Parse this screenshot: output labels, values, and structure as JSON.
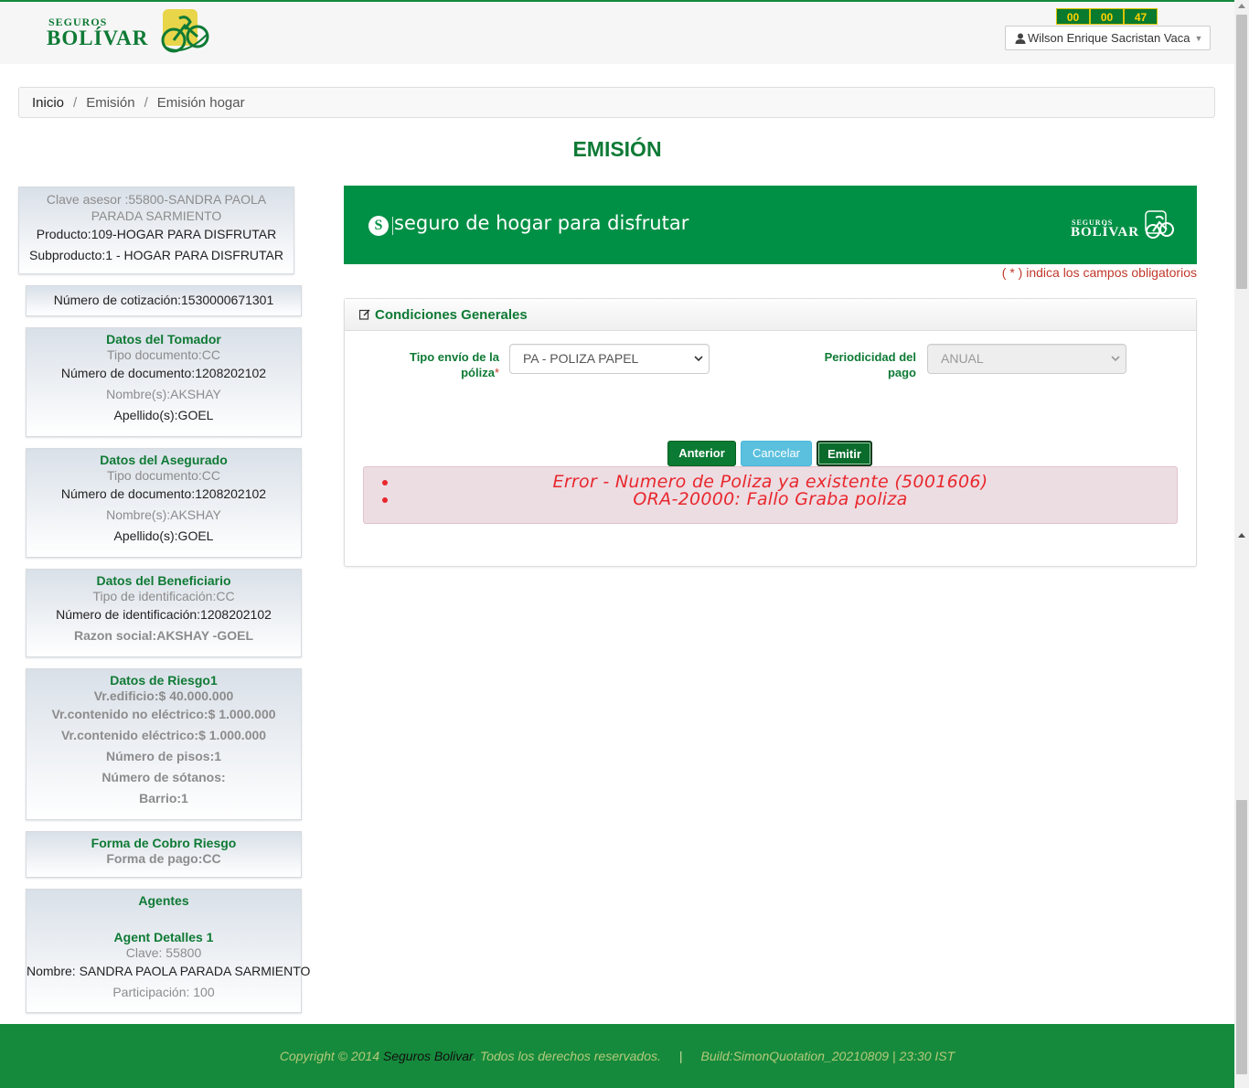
{
  "header": {
    "brand_small": "SEGUROS",
    "brand_big": "BOLÍVAR",
    "timer": [
      "00",
      "00",
      "47"
    ],
    "user_name": "Wilson Enrique Sacristan Vaca"
  },
  "breadcrumb": [
    "Inicio",
    "Emisión",
    "Emisión hogar"
  ],
  "page_title": "EMISIÓN",
  "sidebar": {
    "advisor": {
      "clave": "Clave asesor :55800-SANDRA PAOLA PARADA SARMIENTO",
      "producto": "Producto:109-HOGAR PARA DISFRUTAR",
      "subproducto": "Subproducto:1 - HOGAR PARA DISFRUTAR"
    },
    "cotizacion": "Número de cotización:1530000671301",
    "tomador": {
      "title": "Datos del Tomador",
      "tipo": "Tipo documento:CC",
      "numero": "Número de documento:1208202102",
      "nombre": "Nombre(s):AKSHAY",
      "apellido": "Apellido(s):GOEL"
    },
    "asegurado": {
      "title": "Datos del Asegurado",
      "tipo": "Tipo documento:CC",
      "numero": "Número de documento:1208202102",
      "nombre": "Nombre(s):AKSHAY",
      "apellido": "Apellido(s):GOEL"
    },
    "beneficiario": {
      "title": "Datos del Beneficiario",
      "tipo": "Tipo de identificación:CC",
      "numero": "Número de identificación:1208202102",
      "razon": "Razon social:AKSHAY -GOEL"
    },
    "riesgo": {
      "title": "Datos de Riesgo1",
      "edificio": "Vr.edificio:$ 40.000.000",
      "no_electrico": "Vr.contenido no eléctrico:$ 1.000.000",
      "electrico": "Vr.contenido eléctrico:$ 1.000.000",
      "pisos": "Número de pisos:1",
      "sotanos": "Número de sótanos:",
      "barrio": "Barrio:1"
    },
    "cobro": {
      "title": "Forma de Cobro Riesgo",
      "forma": "Forma de pago:CC"
    },
    "agentes": {
      "title": "Agentes",
      "subtitle": "Agent Detalles 1",
      "clave": "Clave: 55800",
      "nombre": "Nombre: SANDRA PAOLA PARADA SARMIENTO",
      "participacion": "Participación: 100"
    }
  },
  "banner": {
    "s_letter": "S",
    "slogan": "seguro de hogar para disfrutar",
    "brand_small": "SEGUROS",
    "brand_big": "BOLÍVAR"
  },
  "required_note": {
    "open": "( ",
    "star": "*",
    "close": " ) indica los campos obligatorios"
  },
  "panel": {
    "title": "Condiciones Generales",
    "field1_label_a": "Tipo envío de la",
    "field1_label_b": "póliza",
    "field1_req": "*",
    "field1_value": "PA - POLIZA PAPEL",
    "field2_label_a": "Periodicidad del",
    "field2_label_b": "pago",
    "field2_value": "ANUAL"
  },
  "buttons": {
    "anterior": "Anterior",
    "cancelar": "Cancelar",
    "emitir": "Emitir"
  },
  "errors": [
    "Error - Numero de Poliza ya existente (5001606)",
    "ORA-20000: Fallo Graba poliza"
  ],
  "footer": {
    "copyright": "Copyright © 2014 ",
    "brand": "Seguros Bolivar",
    "rights": ". Todos los derechos reservados.",
    "pipe": "|",
    "build": "Build:SimonQuotation_20210809 | 23:30 IST"
  },
  "colors": {
    "brand_green": "#168a3c",
    "error_red": "#e8272c",
    "timer_yellow": "#ffd200"
  }
}
